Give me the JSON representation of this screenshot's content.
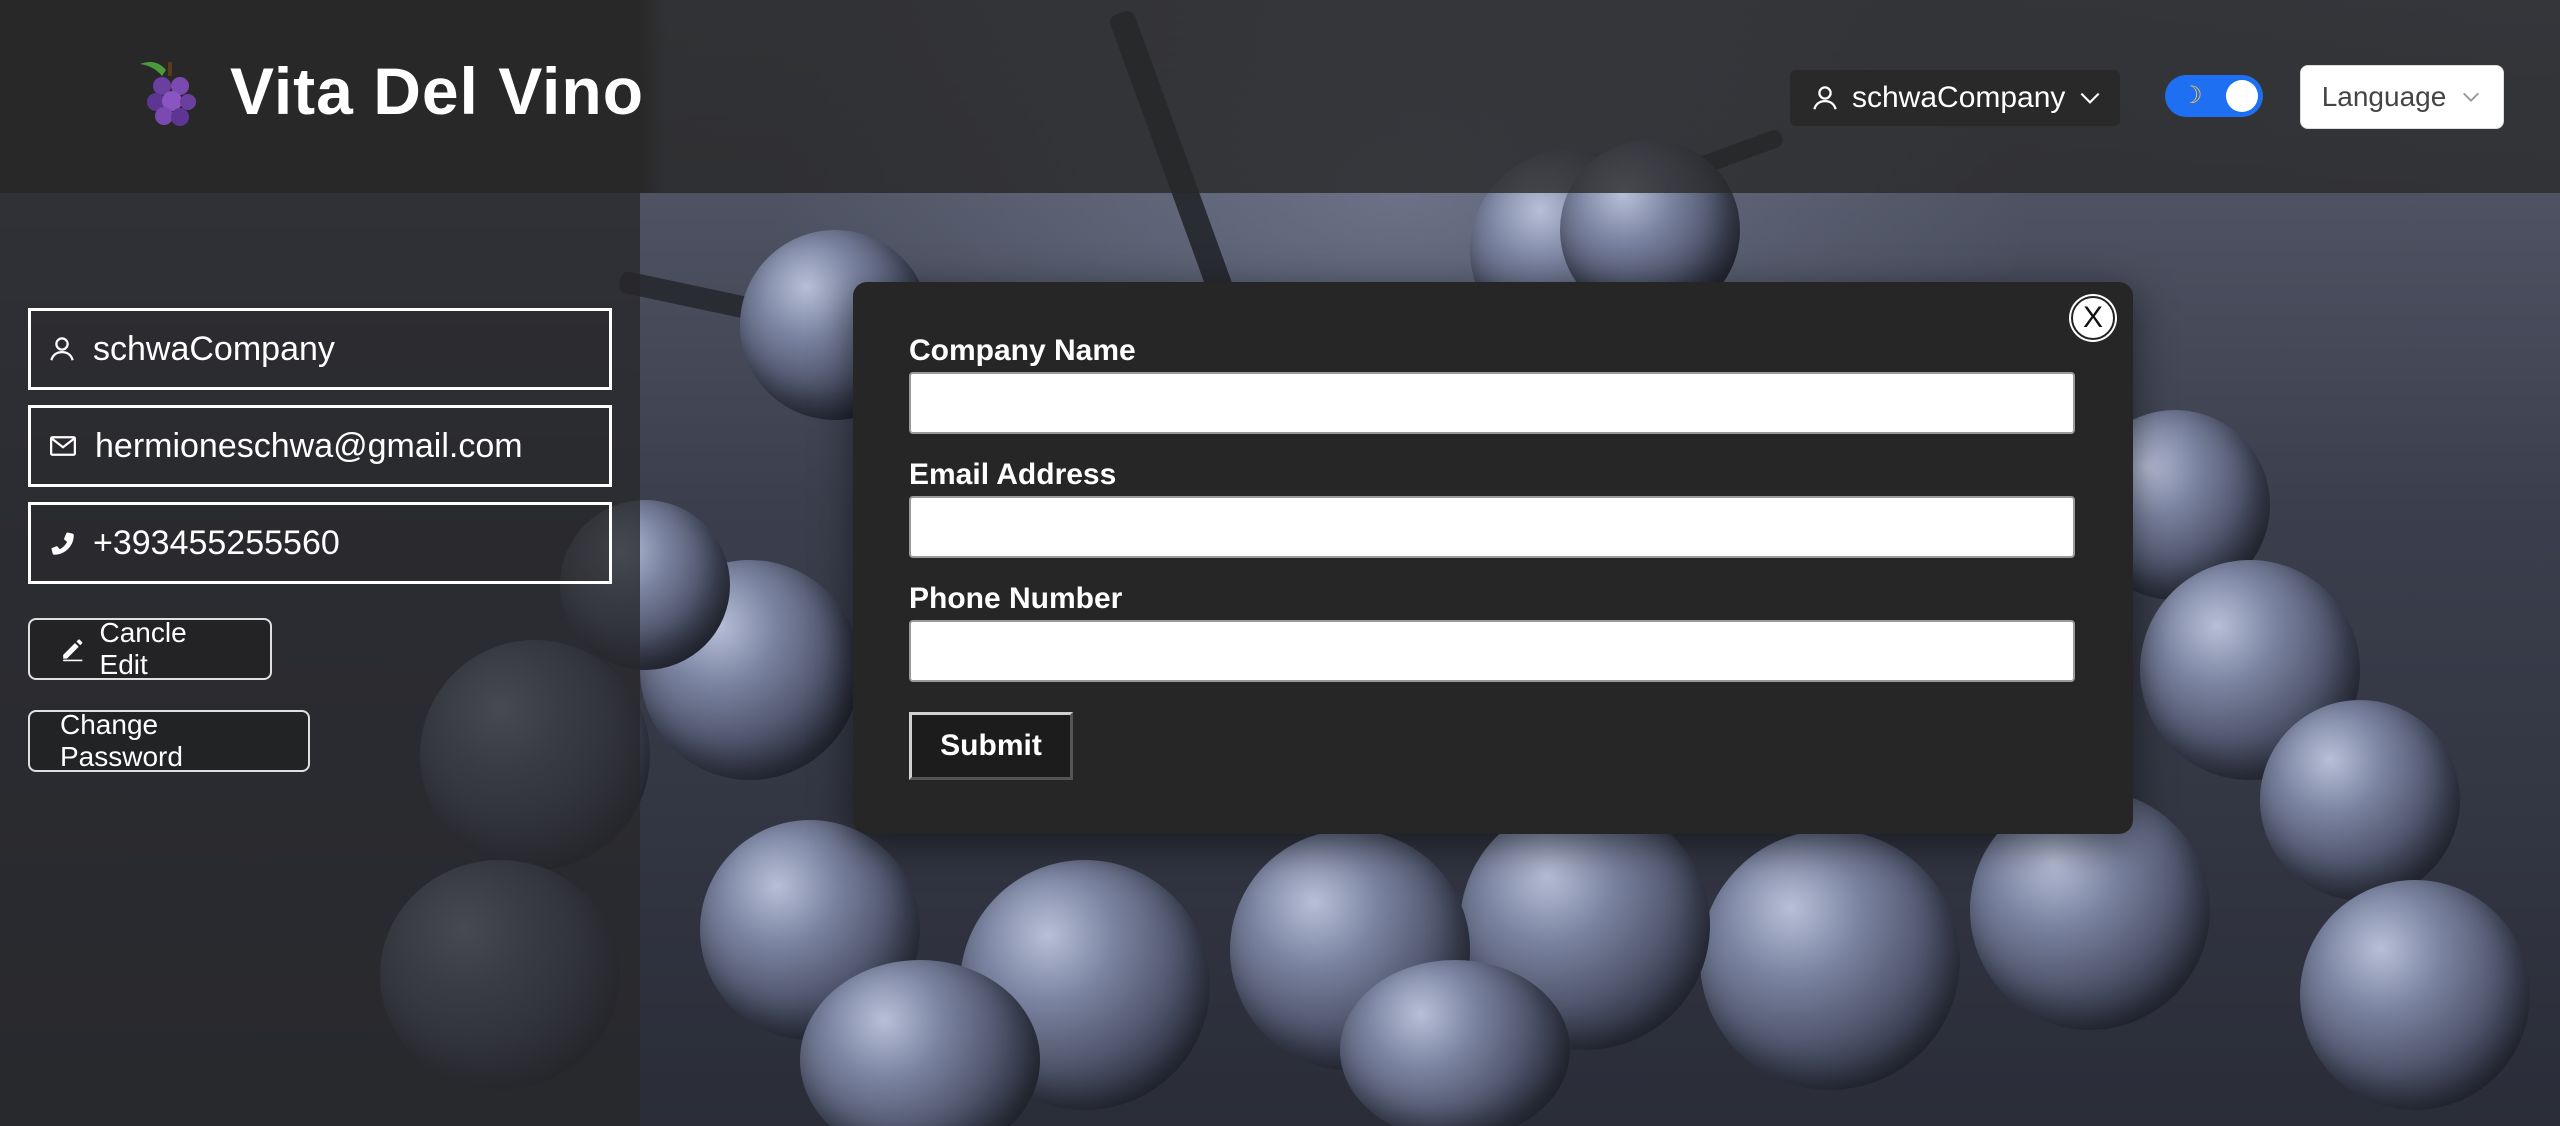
{
  "header": {
    "brand": "Vita Del Vino",
    "user_menu_label": "schwaCompany",
    "language_label": "Language"
  },
  "sidebar": {
    "username": "schwaCompany",
    "email": "hermioneschwa@gmail.com",
    "phone": "+393455255560",
    "cancel_edit_label": "Cancle Edit",
    "change_password_label": "Change Password"
  },
  "modal": {
    "close_label": "X",
    "fields": [
      {
        "label": "Company Name",
        "value": ""
      },
      {
        "label": "Email Address",
        "value": ""
      },
      {
        "label": "Phone Number",
        "value": ""
      }
    ],
    "submit_label": "Submit"
  },
  "colors": {
    "toggle_accent": "#1e6ff2",
    "grape": "#6b3fa0",
    "leaf": "#4a9a3a"
  }
}
